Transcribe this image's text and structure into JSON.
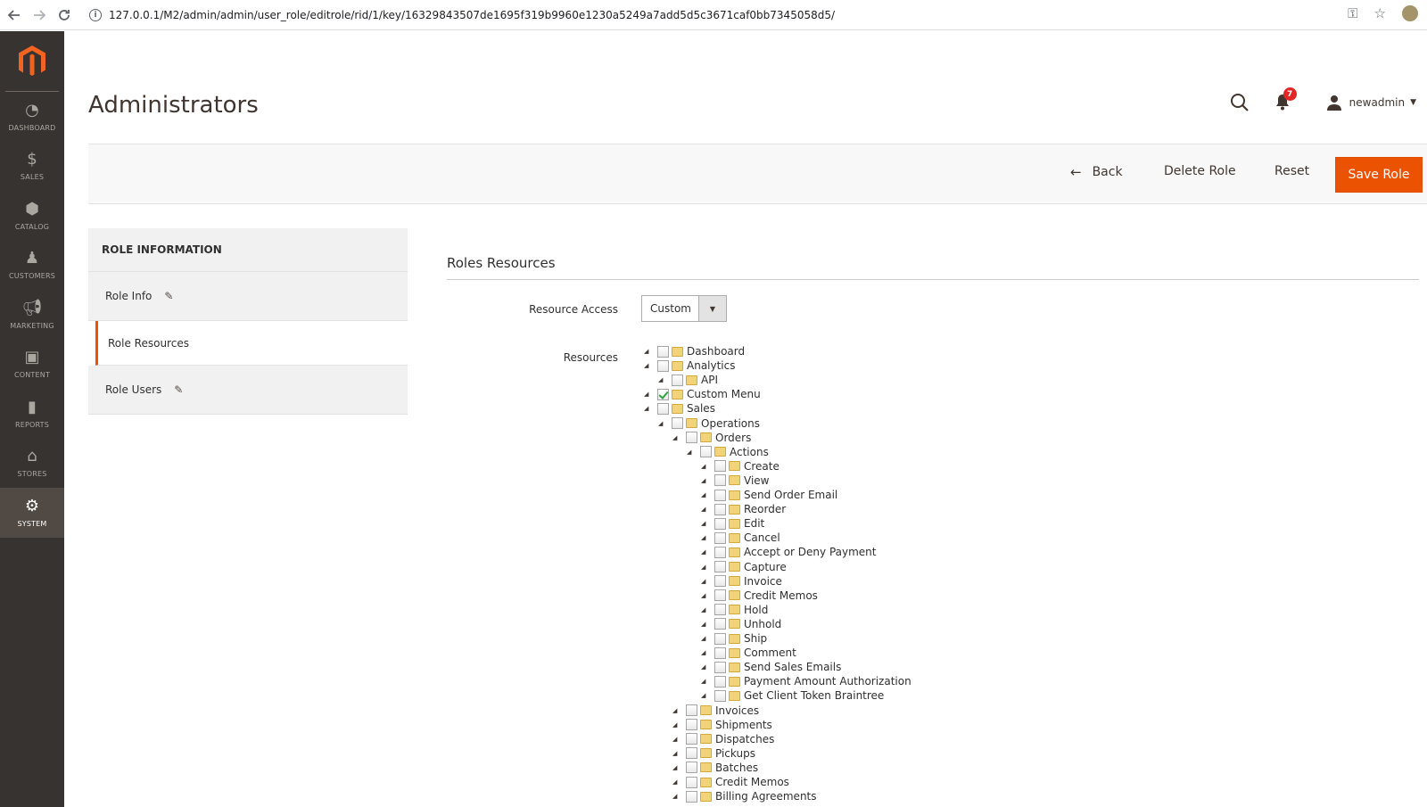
{
  "browser": {
    "url": "127.0.0.1/M2/admin/admin/user_role/editrole/rid/1/key/16329843507de1695f319b9960e1230a5249a7add5d5c3671caf0bb7345058d5/"
  },
  "sidebar": {
    "items": [
      {
        "label": "DASHBOARD",
        "icon": "dashboard-icon"
      },
      {
        "label": "SALES",
        "icon": "dollar-icon"
      },
      {
        "label": "CATALOG",
        "icon": "box-icon"
      },
      {
        "label": "CUSTOMERS",
        "icon": "person-icon"
      },
      {
        "label": "MARKETING",
        "icon": "megaphone-icon"
      },
      {
        "label": "CONTENT",
        "icon": "layout-icon"
      },
      {
        "label": "REPORTS",
        "icon": "bar-chart-icon"
      },
      {
        "label": "STORES",
        "icon": "store-icon"
      },
      {
        "label": "SYSTEM",
        "icon": "gear-icon",
        "active": true
      }
    ]
  },
  "header": {
    "title": "Administrators",
    "notification_count": "7",
    "user": "newadmin"
  },
  "actions": {
    "back": "Back",
    "delete": "Delete Role",
    "reset": "Reset",
    "save": "Save Role"
  },
  "role_tabs": {
    "title": "ROLE INFORMATION",
    "tabs": [
      {
        "label": "Role Info"
      },
      {
        "label": "Role Resources",
        "active": true
      },
      {
        "label": "Role Users"
      }
    ]
  },
  "content": {
    "section_title": "Roles Resources",
    "resource_access_label": "Resource Access",
    "resource_access_value": "Custom",
    "resources_label": "Resources"
  },
  "tree": [
    {
      "label": "Dashboard",
      "level": 0,
      "checked": false
    },
    {
      "label": "Analytics",
      "level": 0,
      "checked": false
    },
    {
      "label": "API",
      "level": 1,
      "checked": false
    },
    {
      "label": "Custom Menu",
      "level": 0,
      "checked": true
    },
    {
      "label": "Sales",
      "level": 0,
      "checked": false
    },
    {
      "label": "Operations",
      "level": 1,
      "checked": false
    },
    {
      "label": "Orders",
      "level": 2,
      "checked": false
    },
    {
      "label": "Actions",
      "level": 3,
      "checked": false
    },
    {
      "label": "Create",
      "level": 4,
      "checked": false
    },
    {
      "label": "View",
      "level": 4,
      "checked": false
    },
    {
      "label": "Send Order Email",
      "level": 4,
      "checked": false
    },
    {
      "label": "Reorder",
      "level": 4,
      "checked": false
    },
    {
      "label": "Edit",
      "level": 4,
      "checked": false
    },
    {
      "label": "Cancel",
      "level": 4,
      "checked": false
    },
    {
      "label": "Accept or Deny Payment",
      "level": 4,
      "checked": false
    },
    {
      "label": "Capture",
      "level": 4,
      "checked": false
    },
    {
      "label": "Invoice",
      "level": 4,
      "checked": false
    },
    {
      "label": "Credit Memos",
      "level": 4,
      "checked": false
    },
    {
      "label": "Hold",
      "level": 4,
      "checked": false
    },
    {
      "label": "Unhold",
      "level": 4,
      "checked": false
    },
    {
      "label": "Ship",
      "level": 4,
      "checked": false
    },
    {
      "label": "Comment",
      "level": 4,
      "checked": false
    },
    {
      "label": "Send Sales Emails",
      "level": 4,
      "checked": false
    },
    {
      "label": "Payment Amount Authorization",
      "level": 4,
      "checked": false
    },
    {
      "label": "Get Client Token Braintree",
      "level": 4,
      "checked": false
    },
    {
      "label": "Invoices",
      "level": 2,
      "checked": false
    },
    {
      "label": "Shipments",
      "level": 2,
      "checked": false
    },
    {
      "label": "Dispatches",
      "level": 2,
      "checked": false
    },
    {
      "label": "Pickups",
      "level": 2,
      "checked": false
    },
    {
      "label": "Batches",
      "level": 2,
      "checked": false
    },
    {
      "label": "Credit Memos",
      "level": 2,
      "checked": false
    },
    {
      "label": "Billing Agreements",
      "level": 2,
      "checked": false
    }
  ]
}
